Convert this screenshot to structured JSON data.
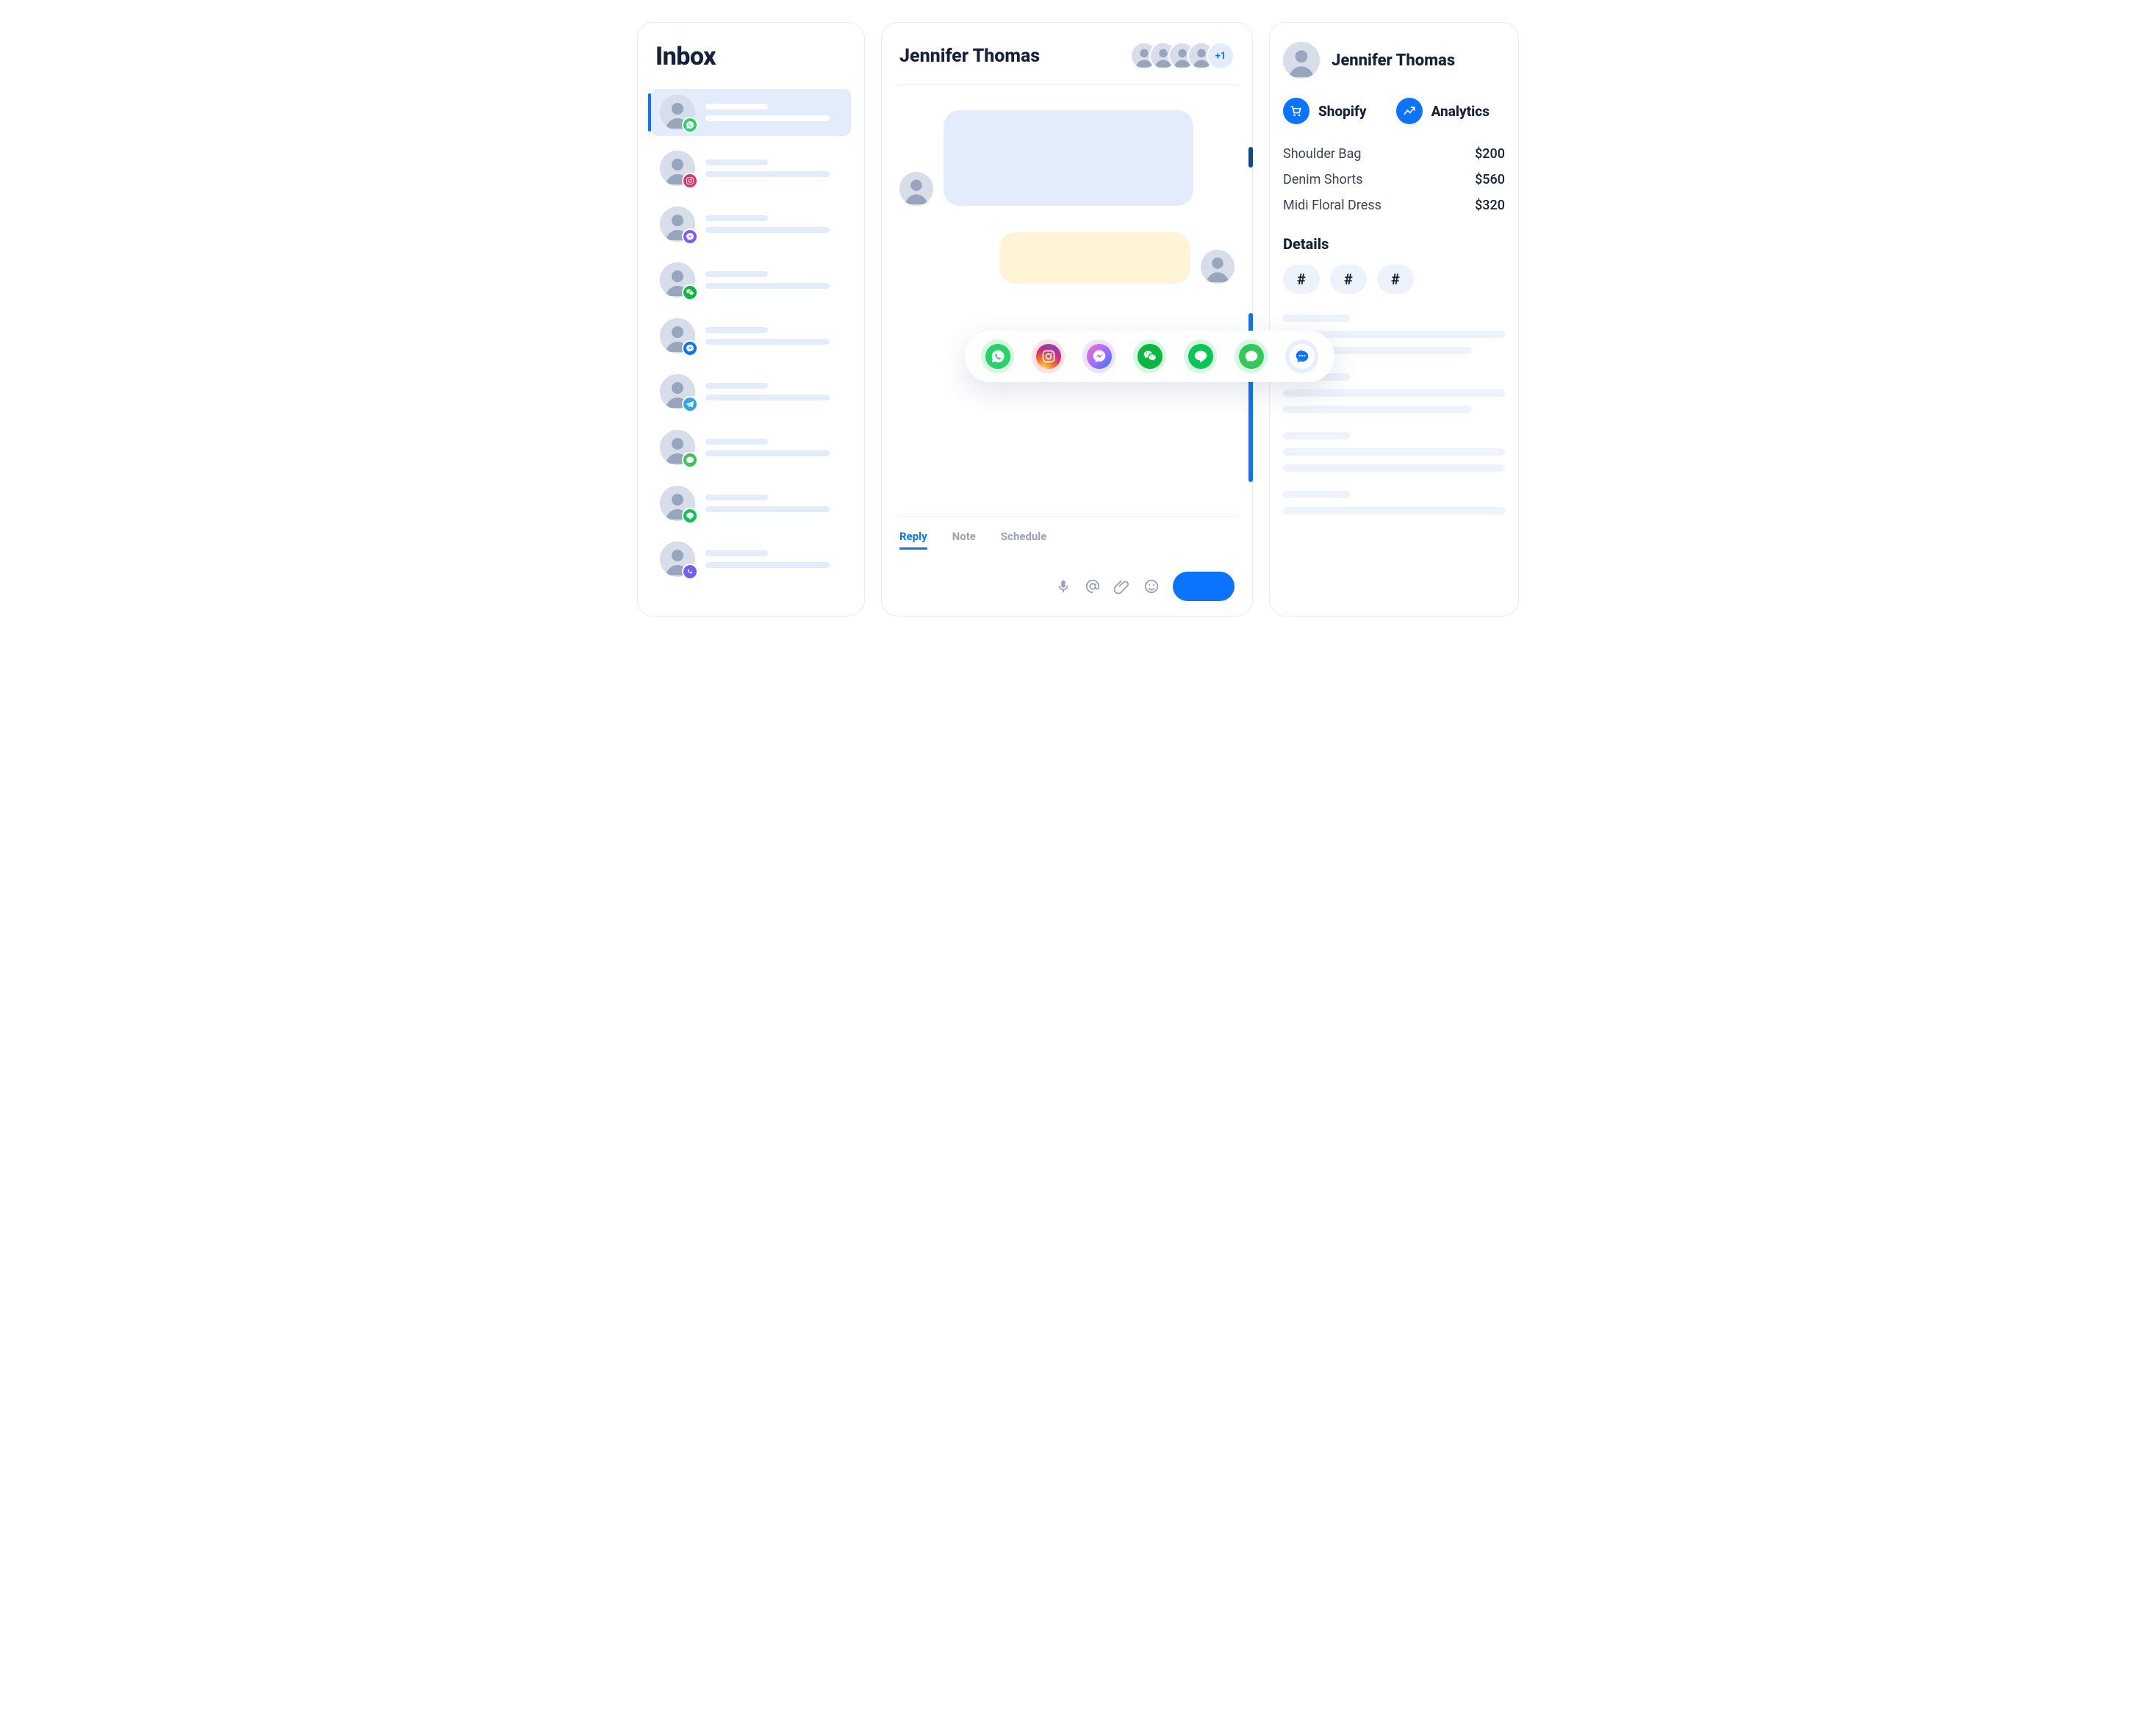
{
  "inbox": {
    "title": "Inbox",
    "items": [
      {
        "channel": "whatsapp",
        "selected": true
      },
      {
        "channel": "instagram",
        "selected": false
      },
      {
        "channel": "messenger",
        "selected": false
      },
      {
        "channel": "wechat",
        "selected": false
      },
      {
        "channel": "messenger_blue",
        "selected": false
      },
      {
        "channel": "telegram",
        "selected": false
      },
      {
        "channel": "sms",
        "selected": false
      },
      {
        "channel": "line",
        "selected": false
      },
      {
        "channel": "viber",
        "selected": false
      }
    ]
  },
  "chat": {
    "title": "Jennifer Thomas",
    "participants_extra": "+1",
    "composer": {
      "tabs": {
        "reply": "Reply",
        "note": "Note",
        "schedule": "Schedule"
      }
    },
    "channels": [
      "whatsapp",
      "instagram",
      "messenger",
      "wechat",
      "line",
      "sms",
      "chat"
    ]
  },
  "profile": {
    "name": "Jennifer Thomas",
    "plugins": {
      "shopify": "Shopify",
      "analytics": "Analytics"
    },
    "orders": [
      {
        "name": "Shoulder Bag",
        "price": "$200"
      },
      {
        "name": "Denim Shorts",
        "price": "$560"
      },
      {
        "name": "Midi Floral Dress",
        "price": "$320"
      }
    ],
    "details_heading": "Details",
    "tags": [
      "#",
      "#",
      "#"
    ]
  },
  "colors": {
    "whatsapp": "#25D366",
    "instagram_bg": "#fde1e7",
    "instagram_a": "#e1306c",
    "messenger_a": "#a23cff",
    "messenger_b": "#3578ff",
    "wechat": "#09b83e",
    "line": "#06c755",
    "sms": "#34c759",
    "telegram": "#29a9eb",
    "viber": "#7360f2",
    "chat": "#0a73ff"
  }
}
